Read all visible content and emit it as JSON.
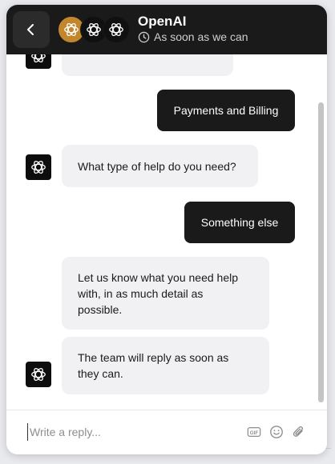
{
  "header": {
    "title": "OpenAI",
    "subtitle": "As soon as we can",
    "back_icon": "chevron-left-icon",
    "avatar_colors": [
      "#c2862d",
      "#101010",
      "#101010"
    ]
  },
  "conversation": {
    "messages": [
      {
        "from": "bot",
        "text": ""
      },
      {
        "from": "user",
        "text": "Payments and Billing"
      },
      {
        "from": "bot",
        "text": "What type of help do you need?"
      },
      {
        "from": "user",
        "text": "Something else"
      },
      {
        "from": "bot",
        "text": "Let us know what you need help with, in as much detail as possible."
      },
      {
        "from": "bot",
        "text": "The team will reply as soon as they can."
      }
    ]
  },
  "composer": {
    "placeholder": "Write a reply...",
    "icons": [
      "gif-icon",
      "emoji-icon",
      "paperclip-icon"
    ],
    "gif_label": "GIF"
  },
  "colors": {
    "header_bg": "#1a1a1a",
    "user_bubble": "#1a1a1a",
    "bot_bubble": "#f1f1f3"
  }
}
